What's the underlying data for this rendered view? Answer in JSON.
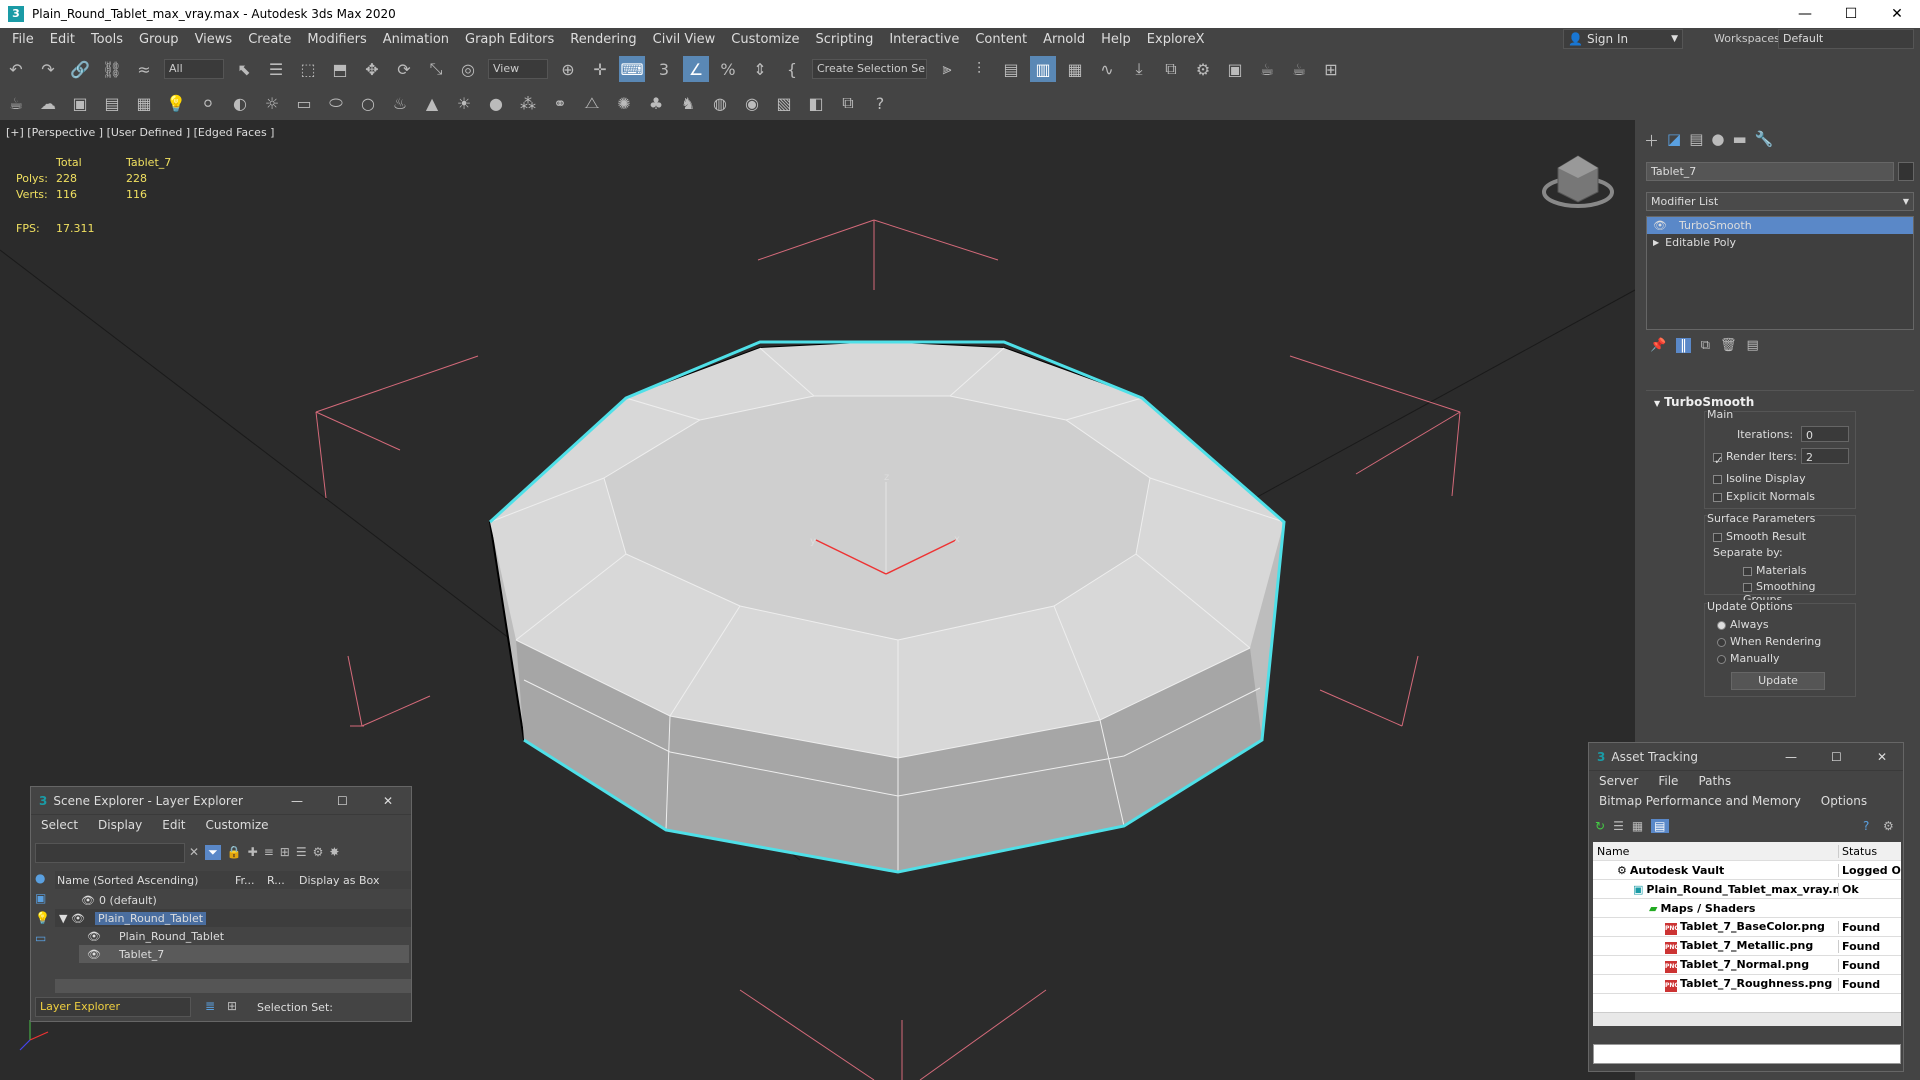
{
  "window": {
    "title": "Plain_Round_Tablet_max_vray.max - Autodesk 3ds Max 2020",
    "app_icon": "3"
  },
  "menu": [
    "File",
    "Edit",
    "Tools",
    "Group",
    "Views",
    "Create",
    "Modifiers",
    "Animation",
    "Graph Editors",
    "Rendering",
    "Civil View",
    "Customize",
    "Scripting",
    "Interactive",
    "Content",
    "Arnold",
    "Help",
    "ExploreX"
  ],
  "account": {
    "sign_in": "Sign In",
    "workspaces_label": "Workspaces:",
    "workspace": "Default"
  },
  "toolbar": {
    "filter": "All",
    "ref_coord": "View",
    "selection_set": "Create Selection Se"
  },
  "viewport": {
    "label": "[+] [Perspective ] [User Defined ] [Edged Faces ]",
    "stats": {
      "total_label": "Total",
      "object_label": "Tablet_7",
      "polys_label": "Polys:",
      "polys_total": "228",
      "polys_obj": "228",
      "verts_label": "Verts:",
      "verts_total": "116",
      "verts_obj": "116",
      "fps_label": "FPS:",
      "fps": "17.311"
    },
    "gizmo": {
      "x": "x",
      "y": "y",
      "z": "z"
    }
  },
  "command_panel": {
    "object_name": "Tablet_7",
    "modifier_list": "Modifier List",
    "stack": [
      "TurboSmooth",
      "Editable Poly"
    ],
    "rollout_title": "TurboSmooth",
    "main_label": "Main",
    "iterations_label": "Iterations:",
    "iterations": "0",
    "render_iters_label": "Render Iters:",
    "render_iters": "2",
    "isoline": "Isoline Display",
    "explicit_normals": "Explicit Normals",
    "surface_params": "Surface Parameters",
    "smooth_result": "Smooth Result",
    "separate_by": "Separate by:",
    "materials": "Materials",
    "smoothing_groups": "Smoothing Groups",
    "update_options": "Update Options",
    "always": "Always",
    "when_rendering": "When Rendering",
    "manually": "Manually",
    "update_btn": "Update"
  },
  "scene_explorer": {
    "title": "Scene Explorer - Layer Explorer",
    "menu": [
      "Select",
      "Display",
      "Edit",
      "Customize"
    ],
    "col_name": "Name (Sorted Ascending)",
    "col_fr": "Fr...",
    "col_r": "R...",
    "col_box": "Display as Box",
    "rows": [
      "0 (default)",
      "Plain_Round_Tablet",
      "Plain_Round_Tablet",
      "Tablet_7"
    ],
    "footer_dropdown": "Layer Explorer",
    "selection_set": "Selection Set:"
  },
  "asset_tracking": {
    "title": "Asset Tracking",
    "menu": [
      "Server",
      "File",
      "Paths"
    ],
    "menu2": [
      "Bitmap Performance and Memory",
      "Options"
    ],
    "col_name": "Name",
    "col_status": "Status",
    "rows": [
      {
        "name": "Autodesk Vault",
        "status": "Logged Ou"
      },
      {
        "name": "Plain_Round_Tablet_max_vray.max",
        "status": "Ok"
      },
      {
        "name": "Maps / Shaders",
        "status": ""
      },
      {
        "name": "Tablet_7_BaseColor.png",
        "status": "Found"
      },
      {
        "name": "Tablet_7_Metallic.png",
        "status": "Found"
      },
      {
        "name": "Tablet_7_Normal.png",
        "status": "Found"
      },
      {
        "name": "Tablet_7_Roughness.png",
        "status": "Found"
      }
    ]
  }
}
